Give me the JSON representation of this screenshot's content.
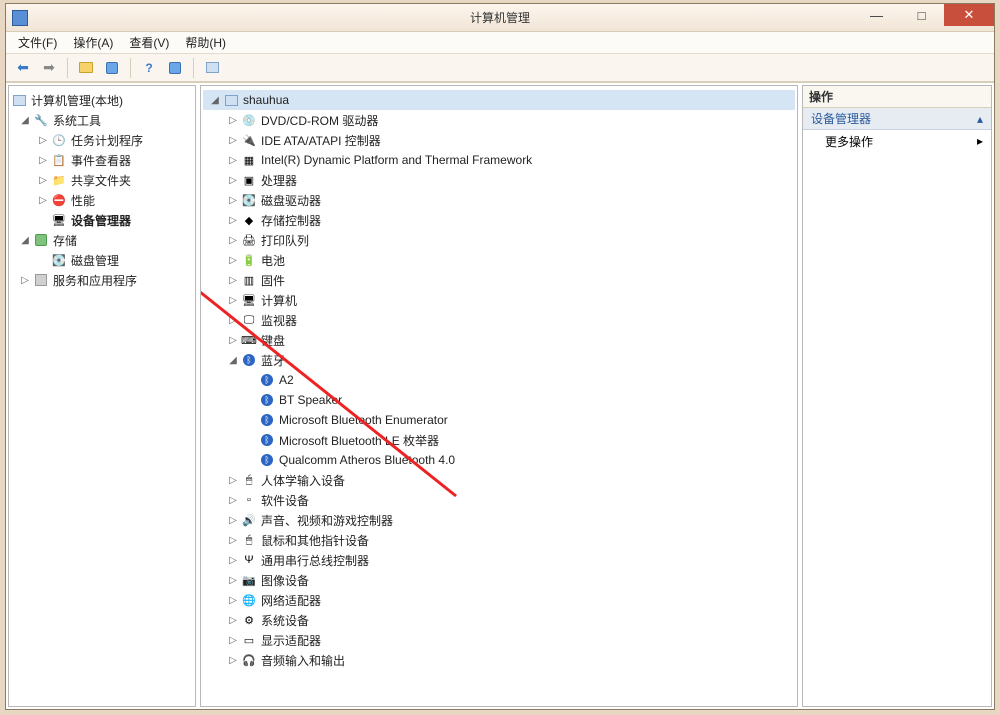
{
  "window": {
    "title": "计算机管理"
  },
  "win_btns": {
    "min": "—",
    "max": "□",
    "close": "✕"
  },
  "menu": [
    "文件(F)",
    "操作(A)",
    "查看(V)",
    "帮助(H)"
  ],
  "toolbar_icons": [
    "back",
    "forward",
    "sep",
    "up",
    "props",
    "sep",
    "help",
    "refresh",
    "sep",
    "show"
  ],
  "left_tree": {
    "root": "计算机管理(本地)",
    "sys_tools": "系统工具",
    "sys_children": [
      {
        "label": "任务计划程序",
        "icon": "clock"
      },
      {
        "label": "事件查看器",
        "icon": "event"
      },
      {
        "label": "共享文件夹",
        "icon": "share"
      },
      {
        "label": "性能",
        "icon": "perf"
      },
      {
        "label": "设备管理器",
        "icon": "devmgr",
        "bold": true
      }
    ],
    "storage": "存储",
    "storage_children": [
      {
        "label": "磁盘管理",
        "icon": "disk"
      }
    ],
    "services": "服务和应用程序"
  },
  "mid_tree": {
    "root": "shauhua",
    "items": [
      {
        "label": "DVD/CD-ROM 驱动器",
        "icon": "cd"
      },
      {
        "label": "IDE ATA/ATAPI 控制器",
        "icon": "ide"
      },
      {
        "label": "Intel(R) Dynamic Platform and Thermal Framework",
        "icon": "chip"
      },
      {
        "label": "处理器",
        "icon": "cpu"
      },
      {
        "label": "磁盘驱动器",
        "icon": "disk"
      },
      {
        "label": "存储控制器",
        "icon": "stor"
      },
      {
        "label": "打印队列",
        "icon": "print"
      },
      {
        "label": "电池",
        "icon": "bat"
      },
      {
        "label": "固件",
        "icon": "fw"
      },
      {
        "label": "计算机",
        "icon": "pc"
      },
      {
        "label": "监视器",
        "icon": "mon"
      },
      {
        "label": "键盘",
        "icon": "kb"
      }
    ],
    "bt": "蓝牙",
    "bt_children": [
      "A2",
      "BT Speaker",
      "Microsoft Bluetooth Enumerator",
      "Microsoft Bluetooth LE 枚举器",
      "Qualcomm Atheros Bluetooth 4.0"
    ],
    "items2": [
      {
        "label": "人体学输入设备",
        "icon": "hid"
      },
      {
        "label": "软件设备",
        "icon": "sw"
      },
      {
        "label": "声音、视频和游戏控制器",
        "icon": "snd"
      },
      {
        "label": "鼠标和其他指针设备",
        "icon": "mouse"
      },
      {
        "label": "通用串行总线控制器",
        "icon": "usb"
      },
      {
        "label": "图像设备",
        "icon": "img"
      },
      {
        "label": "网络适配器",
        "icon": "net"
      },
      {
        "label": "系统设备",
        "icon": "sys"
      },
      {
        "label": "显示适配器",
        "icon": "gpu"
      },
      {
        "label": "音频输入和输出",
        "icon": "audio"
      }
    ]
  },
  "right_panel": {
    "header": "操作",
    "section": "设备管理器",
    "more": "更多操作"
  },
  "glyphs": {
    "tri_open": "◢",
    "tri_closed": "▷",
    "chev_up": "▴",
    "chev_right": "▸"
  }
}
